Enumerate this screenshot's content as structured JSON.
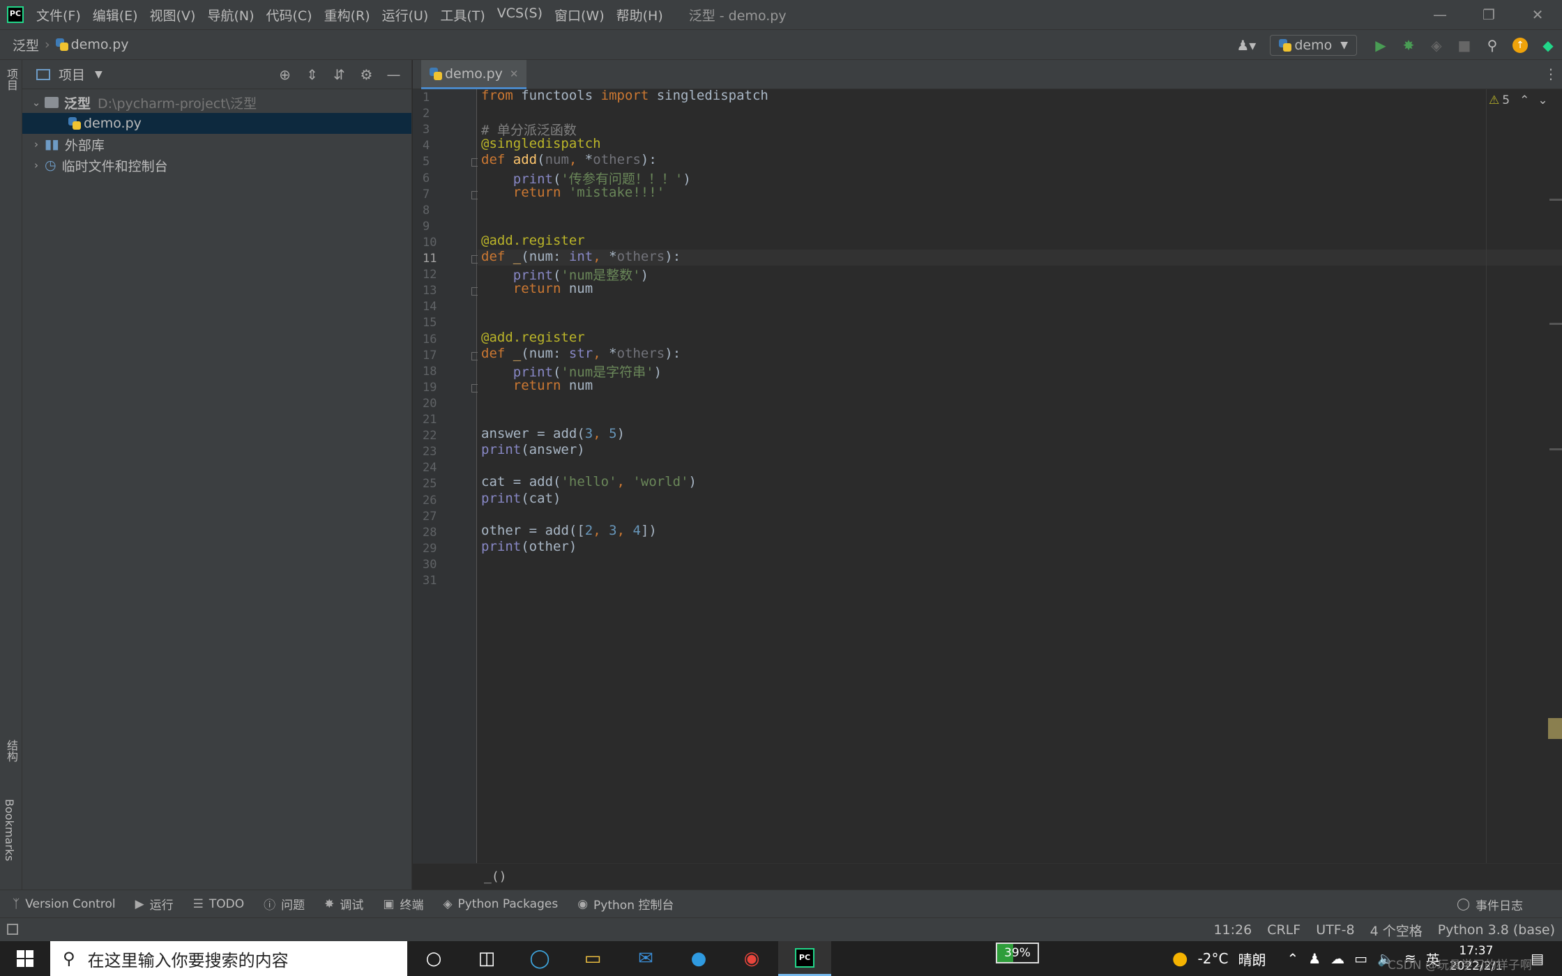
{
  "title_bar": {
    "logo": "PC",
    "menus": [
      "文件(F)",
      "编辑(E)",
      "视图(V)",
      "导航(N)",
      "代码(C)",
      "重构(R)",
      "运行(U)",
      "工具(T)",
      "VCS(S)",
      "窗口(W)",
      "帮助(H)"
    ],
    "window_title": "泛型 - demo.py",
    "controls": [
      "minimize-icon",
      "restore-icon",
      "close-icon"
    ]
  },
  "nav_bar": {
    "breadcrumb": [
      "泛型",
      "demo.py"
    ],
    "run_config": "demo",
    "icons": [
      "user-icon",
      "run-icon",
      "debug-icon",
      "coverage-icon",
      "stop-icon",
      "search-icon",
      "update-icon",
      "plugin-icon"
    ]
  },
  "left_strip": {
    "tabs": [
      "项目",
      "结构",
      "Bookmarks"
    ]
  },
  "project_panel": {
    "title": "项目",
    "tree": [
      {
        "label": "泛型",
        "hint": "D:\\pycharm-project\\泛型",
        "level": 0,
        "expanded": true
      },
      {
        "label": "demo.py",
        "hint": "",
        "level": 1,
        "selected": true
      },
      {
        "label": "外部库",
        "hint": "",
        "level": 0,
        "expanded": false
      },
      {
        "label": "临时文件和控制台",
        "hint": "",
        "level": 0,
        "expanded": false
      }
    ]
  },
  "editor": {
    "tab": "demo.py",
    "warnings": "5",
    "current_line": 11,
    "line_numbers": [
      "1",
      "2",
      "3",
      "4",
      "5",
      "6",
      "7",
      "8",
      "9",
      "10",
      "11",
      "12",
      "13",
      "14",
      "15",
      "16",
      "17",
      "18",
      "19",
      "20",
      "21",
      "22",
      "23",
      "24",
      "25",
      "26",
      "27",
      "28",
      "29",
      "30",
      "31"
    ],
    "code_lines": [
      "from functools import singledispatch",
      "",
      "# 单分派泛函数",
      "@singledispatch",
      "def add(num, *others):",
      "    print('传参有问题！！！')",
      "    return 'mistake!!!'",
      "",
      "",
      "@add.register",
      "def _(num: int, *others):",
      "    print('num是整数')",
      "    return num",
      "",
      "",
      "@add.register",
      "def _(num: str, *others):",
      "    print('num是字符串')",
      "    return num",
      "",
      "",
      "answer = add(3, 5)",
      "print(answer)",
      "",
      "cat = add('hello', 'world')",
      "print(cat)",
      "",
      "other = add([2, 3, 4])",
      "print(other)",
      "",
      ""
    ],
    "code_breadcrumb": "_()"
  },
  "tool_windows": {
    "items": [
      "Version Control",
      "运行",
      "TODO",
      "问题",
      "调试",
      "终端",
      "Python Packages",
      "Python 控制台"
    ],
    "event_log": "事件日志"
  },
  "status_bar": {
    "position": "11:26",
    "line_sep": "CRLF",
    "encoding": "UTF-8",
    "indent": "4 个空格",
    "interpreter": "Python 3.8 (base)"
  },
  "taskbar": {
    "search_placeholder": "在这里输入你要搜索的内容",
    "battery": "39%",
    "battery_level": 0.39,
    "temperature": "-2°C",
    "weather": "晴朗",
    "ime": "英",
    "time": "17:37",
    "date": "2022/2/1",
    "watermark": "CSDN @玩具学习的样子啊"
  }
}
